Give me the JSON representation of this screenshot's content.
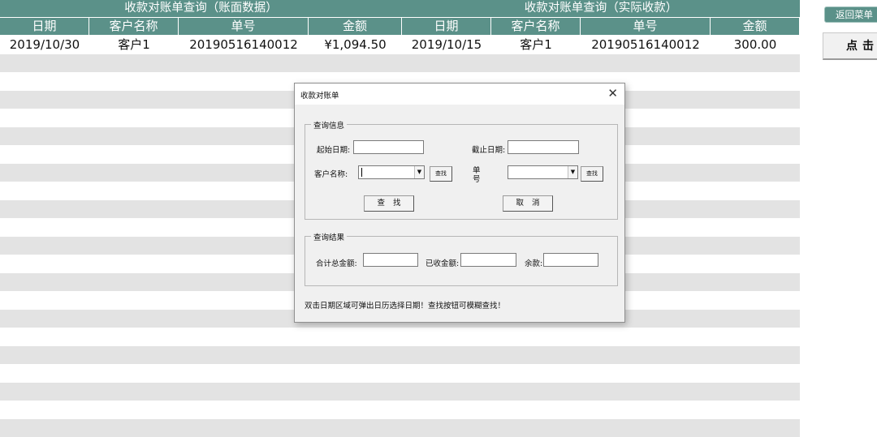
{
  "table": {
    "group_headers": [
      "收款对账单查询（账面数据）",
      "收款对账单查询（实际收款）"
    ],
    "columns": [
      "日期",
      "客户名称",
      "单号",
      "金额",
      "日期",
      "客户名称",
      "单号",
      "金额"
    ],
    "rows": [
      [
        "2019/10/30",
        "客户1",
        "20190516140012",
        "¥1,094.50",
        "2019/10/15",
        "客户1",
        "20190516140012",
        "300.00"
      ]
    ]
  },
  "side": {
    "menu_button": "返回菜单",
    "click_button": "点击查"
  },
  "dialog": {
    "title": "收款对账单",
    "close": "✕",
    "query_frame": {
      "legend": "查询信息",
      "start_date_label": "起始日期:",
      "start_date_value": "",
      "end_date_label": "截止日期:",
      "end_date_value": "",
      "customer_label": "客户名称:",
      "customer_value": "",
      "customer_find": "查找",
      "order_label": "单号",
      "order_value": "",
      "order_find": "查找",
      "search_button": "查找",
      "cancel_button": "取消"
    },
    "result_frame": {
      "legend": "查询结果",
      "total_label": "合计总金额:",
      "total_value": "",
      "received_label": "已收金额:",
      "received_value": "",
      "balance_label": "余款:",
      "balance_value": ""
    },
    "tip": "双击日期区域可弹出日历选择日期！查找按钮可模糊查找！"
  },
  "colors": {
    "header_bg": "#5b9189",
    "band_gray": "#e3e3e3",
    "dialog_bg": "#f0f0f0"
  }
}
